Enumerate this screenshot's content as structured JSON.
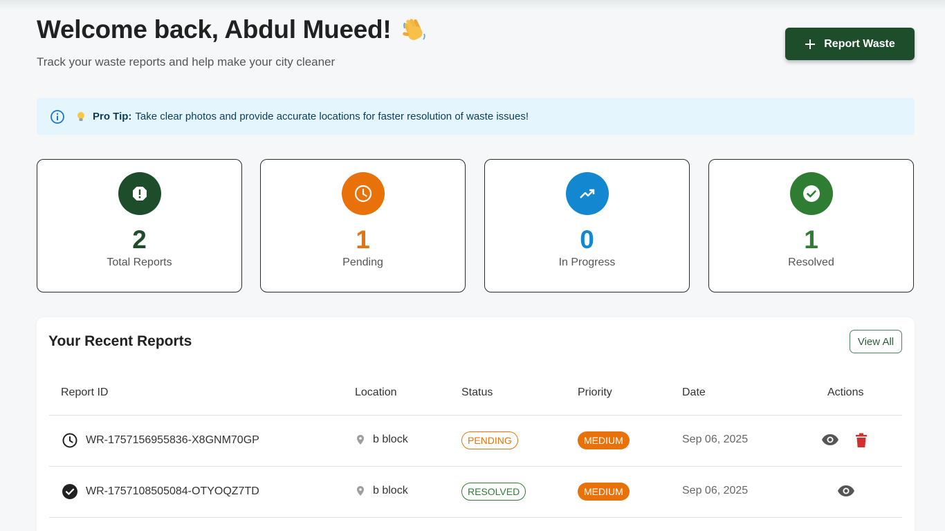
{
  "header": {
    "title": "Welcome back, Abdul Mueed!",
    "subtitle": "Track your waste reports and help make your city cleaner",
    "report_button": "Report Waste"
  },
  "tip": {
    "label": "Pro Tip:",
    "text": "Take clear photos and provide accurate locations for faster resolution of waste issues!"
  },
  "stats": [
    {
      "value": "2",
      "label": "Total Reports",
      "icon": "report-icon",
      "color": "#1e4d2b"
    },
    {
      "value": "1",
      "label": "Pending",
      "icon": "clock-icon",
      "color": "#e8710a"
    },
    {
      "value": "0",
      "label": "In Progress",
      "icon": "trending-up-icon",
      "color": "#1388d1"
    },
    {
      "value": "1",
      "label": "Resolved",
      "icon": "check-circle-icon",
      "color": "#2e7d32"
    }
  ],
  "recent": {
    "title": "Your Recent Reports",
    "view_all": "View All",
    "columns": [
      "Report ID",
      "Location",
      "Status",
      "Priority",
      "Date",
      "Actions"
    ],
    "rows": [
      {
        "id": "WR-1757156955836-X8GNM70GP",
        "location": "b block",
        "status": "PENDING",
        "priority": "MEDIUM",
        "date": "Sep 06, 2025",
        "status_icon": "clock-icon",
        "actions": [
          "view",
          "delete"
        ]
      },
      {
        "id": "WR-1757108505084-OTYOQZ7TD",
        "location": "b block",
        "status": "RESOLVED",
        "priority": "MEDIUM",
        "date": "Sep 06, 2025",
        "status_icon": "check-circle-icon",
        "actions": [
          "view"
        ]
      }
    ]
  }
}
